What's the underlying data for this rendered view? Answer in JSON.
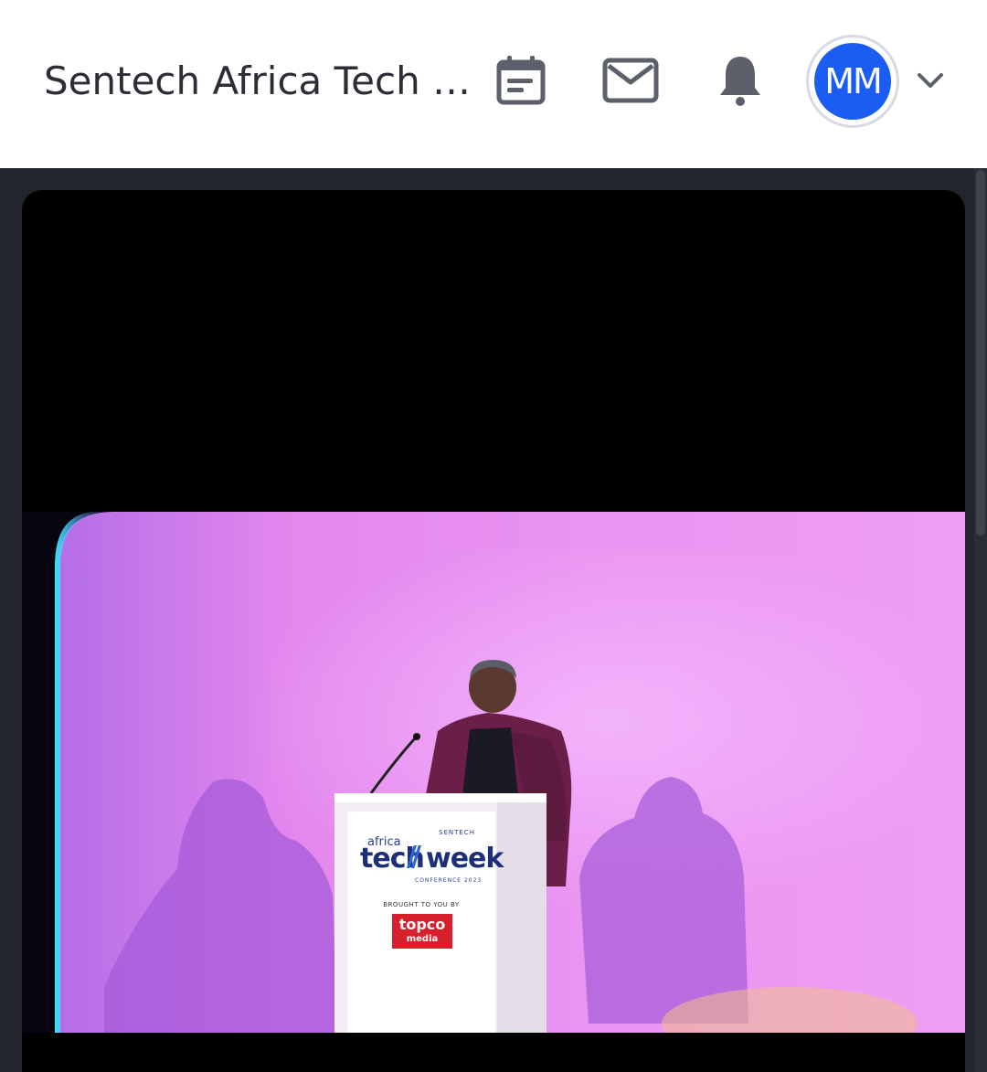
{
  "header": {
    "event_title": "Sentech Africa Tech W…",
    "avatar_initials": "MM",
    "avatar_color": "#1b5cf2",
    "icons": {
      "calendar": "calendar-icon",
      "mail": "mail-icon",
      "bell": "bell-icon",
      "menu": "chevron-down-icon"
    }
  },
  "video": {
    "podium_logo": {
      "africa": "africa",
      "sentech": "SENTECH",
      "tech": "tech",
      "week": "week",
      "conference": "CONFERENCE 2023",
      "brought_by": "BROUGHT TO YOU BY",
      "sponsor_line1": "topco",
      "sponsor_line2": "media"
    }
  },
  "colors": {
    "header_bg": "#ffffff",
    "page_bg": "#22252c",
    "stage_pink": "#e78ff0",
    "stage_purple": "#b870e8",
    "accent_cyan": "#3fe6ff",
    "sponsor_red": "#d7202b"
  }
}
